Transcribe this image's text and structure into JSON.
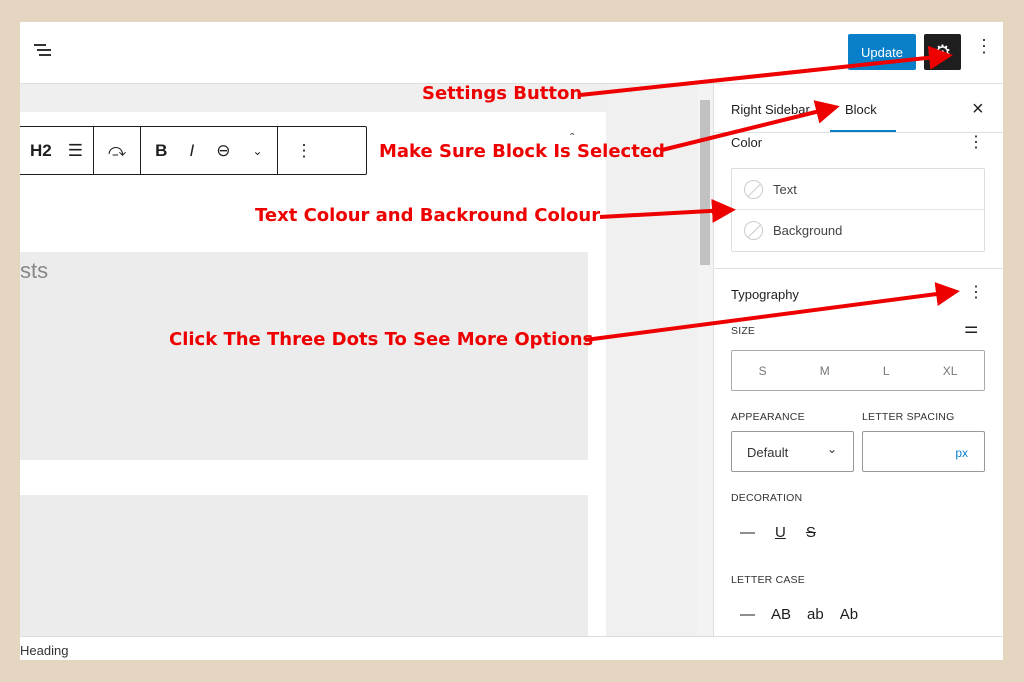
{
  "topbar": {
    "menu_icon": "list-view-icon",
    "update_label": "Update",
    "settings_icon": "gear-icon",
    "more_icon": "vertical-dots-icon"
  },
  "toolbar": {
    "heading_level": "H2",
    "bold": "B",
    "italic": "I",
    "more": "⋮"
  },
  "editor": {
    "ghost_text": "sts"
  },
  "status": {
    "breadcrumb": "Heading"
  },
  "sidebar": {
    "tabs": [
      {
        "label": "Right Sidebar"
      },
      {
        "label": "Block",
        "active": true
      }
    ],
    "close": "×",
    "color": {
      "title": "Color",
      "items": [
        {
          "label": "Text"
        },
        {
          "label": "Background"
        }
      ]
    },
    "typography": {
      "title": "Typography",
      "size_label": "SIZE",
      "sizes": [
        "S",
        "M",
        "L",
        "XL"
      ],
      "appearance_label": "APPEARANCE",
      "appearance_value": "Default",
      "letter_spacing_label": "LETTER SPACING",
      "letter_spacing_unit": "px",
      "decoration_label": "DECORATION",
      "decorations": [
        "—",
        "U",
        "S"
      ],
      "letter_case_label": "LETTER CASE",
      "cases": [
        "—",
        "AB",
        "ab",
        "Ab"
      ]
    }
  },
  "annotations": [
    "Settings Button",
    "Make Sure Block Is Selected",
    "Text Colour and Backround Colour",
    "Click The Three Dots To See More Options"
  ],
  "colors": {
    "annotation": "#e00000",
    "accent": "#0a7fc9",
    "background": "#e5d6c1"
  }
}
